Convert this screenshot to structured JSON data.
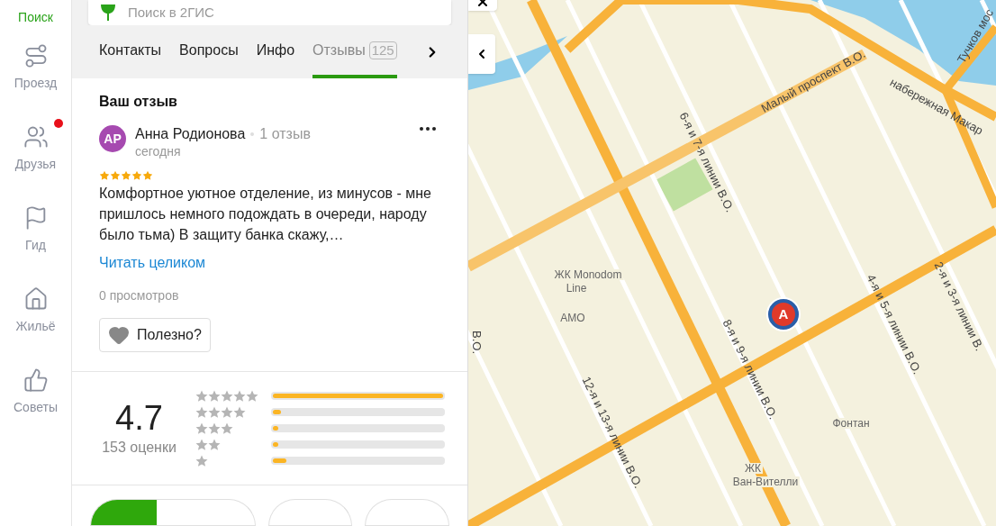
{
  "sidebar": {
    "items": [
      {
        "label": "Поиск",
        "selected": true,
        "badge": false
      },
      {
        "label": "Проезд",
        "selected": false,
        "badge": false
      },
      {
        "label": "Друзья",
        "selected": false,
        "badge": true
      },
      {
        "label": "Гид",
        "selected": false,
        "badge": false
      },
      {
        "label": "Жильё",
        "selected": false,
        "badge": false
      },
      {
        "label": "Советы",
        "selected": false,
        "badge": false
      }
    ]
  },
  "search": {
    "placeholder": "Поиск в 2ГИС"
  },
  "tabs": [
    {
      "label": "Контакты",
      "selected": false
    },
    {
      "label": "Вопросы",
      "selected": false
    },
    {
      "label": "Инфо",
      "selected": false
    },
    {
      "label": "Отзывы",
      "count": "125",
      "selected": true
    }
  ],
  "review": {
    "heading": "Ваш отзыв",
    "avatar": "АР",
    "author": "Анна Родионова",
    "author_reviews": "1 отзыв",
    "date": "сегодня",
    "stars": 5,
    "text": "Комфортное уютное отделение, из минусов - мне пришлось немного подождать в очереди, народу было тьма) В защиту банка скажу,…",
    "read_more": "Читать целиком",
    "views": "0 просмотров",
    "helpful": "Полезно?"
  },
  "rating": {
    "value": "4.7",
    "count": "153 оценки",
    "rows": [
      {
        "level": 1.0
      },
      {
        "level": 0.05
      },
      {
        "level": 0.03
      },
      {
        "level": 0.02
      },
      {
        "level": 0.08
      }
    ]
  },
  "filter_buttons": [
    {
      "selected": true
    },
    {
      "selected": false
    },
    {
      "selected": false
    }
  ],
  "map": {
    "labels": [
      {
        "text": "Малый проспект В.О.",
        "kind": "street"
      },
      {
        "text": "6-я и 7-я линии В.О.",
        "kind": "street"
      },
      {
        "text": "набережная Макар",
        "kind": "street"
      },
      {
        "text": "Тучков мос",
        "kind": "street"
      },
      {
        "text": "ЖК  Monodom",
        "kind": "place"
      },
      {
        "text": "Line",
        "kind": "place"
      },
      {
        "text": "АМО",
        "kind": "place"
      },
      {
        "text": "8-я и 9-я линии В.О.",
        "kind": "street"
      },
      {
        "text": "4-я и 5-я линии В.О.",
        "kind": "street"
      },
      {
        "text": "2-я и 3-я линии В.",
        "kind": "street"
      },
      {
        "text": "12-я и 13-я линии В.О.",
        "kind": "street"
      },
      {
        "text": "Фонтан",
        "kind": "place"
      },
      {
        "text": "ЖК",
        "kind": "place"
      },
      {
        "text": "Ван-Вителли",
        "kind": "place"
      },
      {
        "text": "В.О.",
        "kind": "street"
      }
    ],
    "pin": "А"
  }
}
